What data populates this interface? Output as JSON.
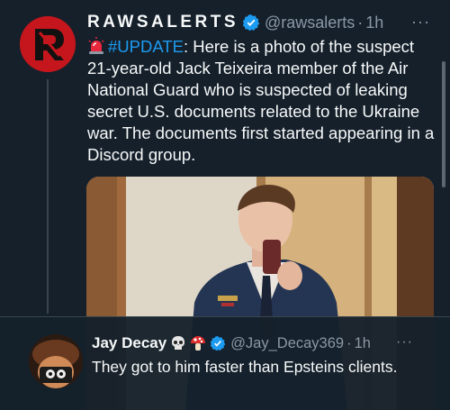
{
  "tweet": {
    "display_name": "RAWSALERTS",
    "verified_icon": "verified-badge-icon",
    "handle": "@rawsalerts",
    "dot": "·",
    "time": "1h",
    "more": "···",
    "text_prefix_emoji": "rotating-light-emoji",
    "hashtag": "#UPDATE",
    "text_body": ": Here is a photo of  the suspect 21-year-old Jack Teixeira member of the Air National Guard who is suspected of leaking secret U.S. documents related to the Ukraine war. The documents first started appearing in a Discord group.",
    "avatar_icon": "rawsalerts-logo"
  },
  "reply": {
    "display_name": "Jay Decay",
    "name_emojis": [
      "skull-emoji",
      "mushroom-emoji"
    ],
    "verified_icon": "verified-badge-icon",
    "handle": "@Jay_Decay369",
    "dot": "·",
    "time": "1h",
    "more": "···",
    "text": "They got to him faster than Epsteins clients."
  },
  "colors": {
    "background": "#15202b",
    "text_primary": "#f7f9f9",
    "text_secondary": "#8b98a5",
    "accent": "#1d9bf0",
    "avatar_brand": "#c4161c"
  }
}
